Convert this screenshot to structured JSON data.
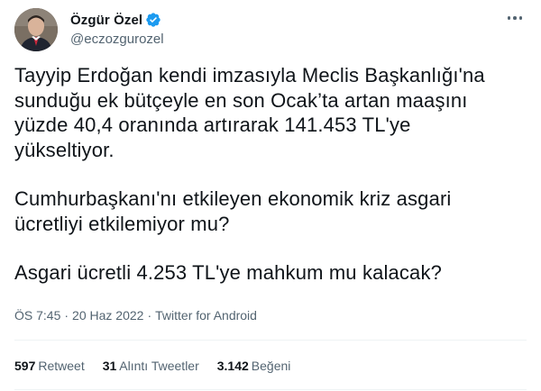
{
  "author": {
    "display_name": "Özgür Özel",
    "handle": "@eczozgurozel",
    "verified": true
  },
  "tweet": {
    "paragraphs": [
      "Tayyip Erdoğan kendi imzasıyla Meclis Başkanlığı'na\nsunduğu ek bütçeyle en son Ocak’ta artan maaşını\nyüzde 40,4 oranında artırarak 141.453 TL'ye\nyükseltiyor.",
      "Cumhurbaşkanı'nı etkileyen ekonomik kriz asgari\nücretliyi etkilemiyor mu?",
      "Asgari ücretli 4.253 TL'ye mahkum mu kalacak?"
    ]
  },
  "meta": {
    "time": "ÖS 7:45",
    "separator": "·",
    "date": "20 Haz 2022",
    "source": "Twitter for Android"
  },
  "stats": {
    "retweets": {
      "count": "597",
      "label": "Retweet"
    },
    "quotes": {
      "count": "31",
      "label": "Alıntı Tweetler"
    },
    "likes": {
      "count": "3.142",
      "label": "Beğeni"
    }
  },
  "colors": {
    "text": "#0f1419",
    "secondary": "#536471",
    "verified": "#1d9bf0",
    "divider": "#eff3f4"
  }
}
